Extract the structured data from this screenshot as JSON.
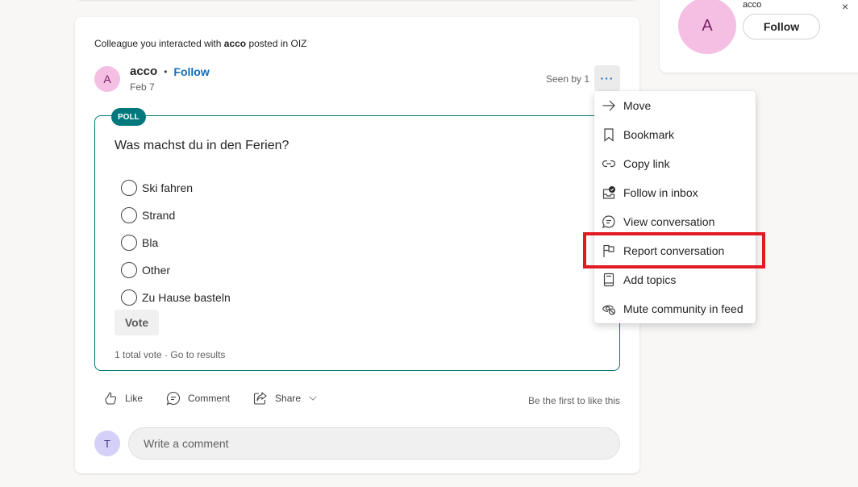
{
  "post": {
    "context_prefix": "Colleague you interacted with ",
    "context_user": "acco",
    "context_middle": " posted in ",
    "context_community": "OIZ",
    "author": {
      "initial": "A",
      "name": "acco",
      "separator": "•",
      "follow_label": "Follow",
      "date": "Feb 7"
    },
    "seen_by": "Seen by 1",
    "more_label": "···",
    "poll": {
      "badge": "POLL",
      "question": "Was machst du in den Ferien?",
      "options": [
        {
          "label": "Ski fahren"
        },
        {
          "label": "Strand"
        },
        {
          "label": "Bla"
        },
        {
          "label": "Other"
        },
        {
          "label": "Zu Hause basteln"
        }
      ],
      "vote_label": "Vote",
      "total_votes": "1 total vote",
      "footer_sep": " · ",
      "results_link": "Go to results"
    },
    "actions": {
      "like": "Like",
      "comment": "Comment",
      "share": "Share",
      "likes_text": "Be the first to like this"
    },
    "comment_box": {
      "user_initial": "T",
      "placeholder": "Write a comment"
    }
  },
  "menu": {
    "items": [
      {
        "label": "Move",
        "icon": "arrow-right-icon"
      },
      {
        "label": "Bookmark",
        "icon": "bookmark-icon"
      },
      {
        "label": "Copy link",
        "icon": "link-icon"
      },
      {
        "label": "Follow in inbox",
        "icon": "inbox-follow-icon"
      },
      {
        "label": "View conversation",
        "icon": "chat-bubble-icon"
      },
      {
        "label": "Report conversation",
        "icon": "flag-icon",
        "highlighted": true
      },
      {
        "label": "Add topics",
        "icon": "topic-icon"
      },
      {
        "label": "Mute community in feed",
        "icon": "eye-mute-icon"
      }
    ],
    "highlight_color": "#e11b22"
  },
  "side_card": {
    "initial": "A",
    "name": "acco",
    "follow_label": "Follow",
    "close_label": "×"
  },
  "colors": {
    "accent": "#0f6cbd",
    "poll_teal": "#03787c"
  }
}
